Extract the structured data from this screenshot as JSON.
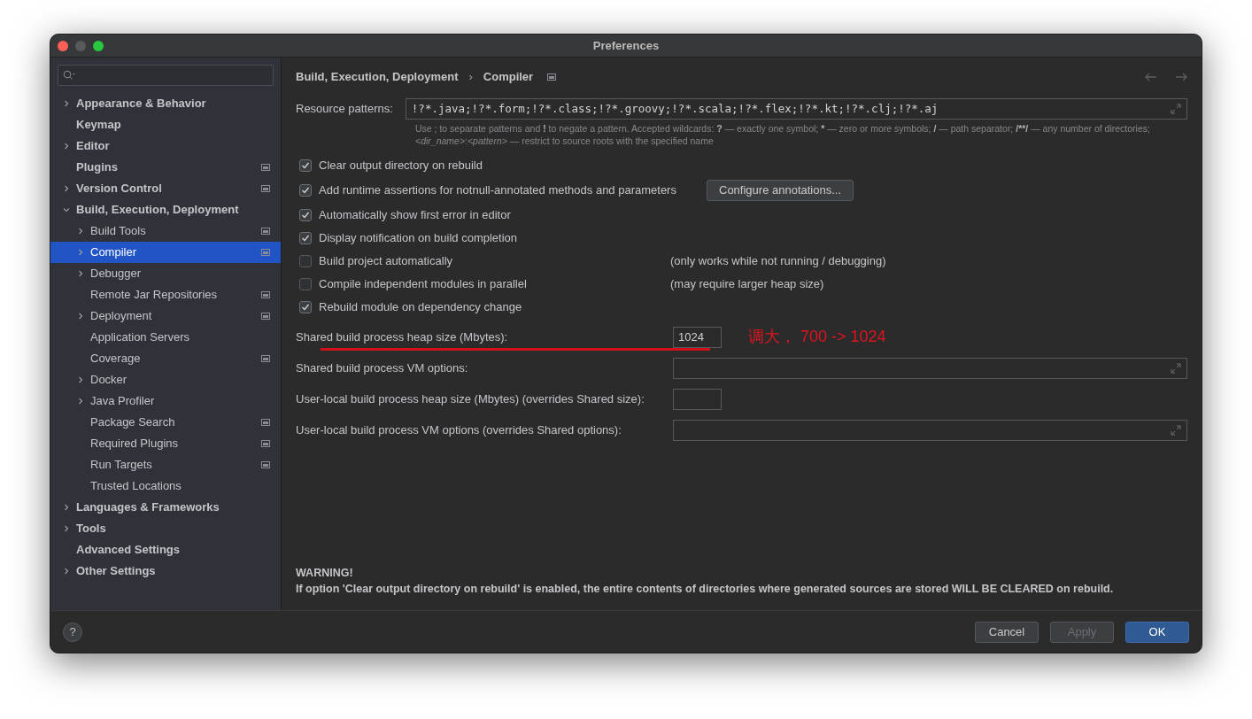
{
  "window": {
    "title": "Preferences"
  },
  "sidebar": {
    "items": [
      {
        "label": "Appearance & Behavior",
        "expandable": true,
        "expanded": false,
        "selected": false,
        "badge": false
      },
      {
        "label": "Keymap",
        "expandable": false,
        "selected": false,
        "badge": false
      },
      {
        "label": "Editor",
        "expandable": true,
        "expanded": false,
        "selected": false,
        "badge": false
      },
      {
        "label": "Plugins",
        "expandable": false,
        "selected": false,
        "badge": true
      },
      {
        "label": "Version Control",
        "expandable": true,
        "expanded": false,
        "selected": false,
        "badge": true
      },
      {
        "label": "Build, Execution, Deployment",
        "expandable": true,
        "expanded": true,
        "selected": false,
        "badge": false,
        "children": [
          {
            "label": "Build Tools",
            "expandable": true,
            "expanded": false,
            "selected": false,
            "badge": true
          },
          {
            "label": "Compiler",
            "expandable": true,
            "expanded": false,
            "selected": true,
            "badge": true
          },
          {
            "label": "Debugger",
            "expandable": true,
            "expanded": false,
            "selected": false,
            "badge": false
          },
          {
            "label": "Remote Jar Repositories",
            "expandable": false,
            "selected": false,
            "badge": true
          },
          {
            "label": "Deployment",
            "expandable": true,
            "expanded": false,
            "selected": false,
            "badge": true
          },
          {
            "label": "Application Servers",
            "expandable": false,
            "selected": false,
            "badge": false
          },
          {
            "label": "Coverage",
            "expandable": false,
            "selected": false,
            "badge": true
          },
          {
            "label": "Docker",
            "expandable": true,
            "expanded": false,
            "selected": false,
            "badge": false
          },
          {
            "label": "Java Profiler",
            "expandable": true,
            "expanded": false,
            "selected": false,
            "badge": false
          },
          {
            "label": "Package Search",
            "expandable": false,
            "selected": false,
            "badge": true
          },
          {
            "label": "Required Plugins",
            "expandable": false,
            "selected": false,
            "badge": true
          },
          {
            "label": "Run Targets",
            "expandable": false,
            "selected": false,
            "badge": true
          },
          {
            "label": "Trusted Locations",
            "expandable": false,
            "selected": false,
            "badge": false
          }
        ]
      },
      {
        "label": "Languages & Frameworks",
        "expandable": true,
        "expanded": false,
        "selected": false,
        "badge": false
      },
      {
        "label": "Tools",
        "expandable": true,
        "expanded": false,
        "selected": false,
        "badge": false
      },
      {
        "label": "Advanced Settings",
        "expandable": false,
        "selected": false,
        "badge": false
      },
      {
        "label": "Other Settings",
        "expandable": true,
        "expanded": false,
        "selected": false,
        "badge": false
      }
    ]
  },
  "breadcrumb": [
    "Build, Execution, Deployment",
    "Compiler"
  ],
  "breadcrumb_separator": "›",
  "help_button": "?",
  "resource_patterns": {
    "label": "Resource patterns:",
    "value": "!?*.java;!?*.form;!?*.class;!?*.groovy;!?*.scala;!?*.flex;!?*.kt;!?*.clj;!?*.aj",
    "hint": [
      {
        "text": "Use ; to separate patterns and "
      },
      {
        "text": "!",
        "bold": true
      },
      {
        "text": " to negate a pattern. Accepted wildcards: "
      },
      {
        "text": "?",
        "bold": true
      },
      {
        "text": " — exactly one symbol; "
      },
      {
        "text": "*",
        "bold": true
      },
      {
        "text": " — zero or more symbols; "
      },
      {
        "text": "/",
        "bold": true
      },
      {
        "text": " — path separator; "
      },
      {
        "text": "/**/",
        "bold": true
      },
      {
        "text": " — any number of directories; "
      },
      {
        "text": "<dir_name>",
        "italic": true
      },
      {
        "text": ":"
      },
      {
        "text": "<pattern>",
        "italic": true
      },
      {
        "text": " — restrict to source roots with the specified name"
      }
    ]
  },
  "options": [
    {
      "label": "Clear output directory on rebuild",
      "checked": true
    },
    {
      "label": "Add runtime assertions for notnull-annotated methods and parameters",
      "checked": true,
      "button": "Configure annotations..."
    },
    {
      "label": "Automatically show first error in editor",
      "checked": true
    },
    {
      "label": "Display notification on build completion",
      "checked": true
    },
    {
      "label": "Build project automatically",
      "checked": false,
      "note": "(only works while not running / debugging)"
    },
    {
      "label": "Compile independent modules in parallel",
      "checked": false,
      "note": "(may require larger heap size)"
    },
    {
      "label": "Rebuild module on dependency change",
      "checked": true
    }
  ],
  "fields": [
    {
      "label": "Shared build process heap size (Mbytes):",
      "kind": "short",
      "value": "1024",
      "annotation": "调大， 700 -> 1024"
    },
    {
      "label": "Shared build process VM options:",
      "kind": "wide"
    },
    {
      "label": "User-local build process heap size (Mbytes) (overrides Shared size):",
      "kind": "short"
    },
    {
      "label": "User-local build process VM options (overrides Shared options):",
      "kind": "wide"
    }
  ],
  "warning": {
    "title": "WARNING!",
    "text": "If option 'Clear output directory on rebuild' is enabled, the entire contents of directories where generated sources are stored WILL BE CLEARED on rebuild."
  },
  "buttons": [
    {
      "label": "Cancel",
      "kind": "normal",
      "disabled": false
    },
    {
      "label": "Apply",
      "kind": "normal",
      "disabled": true
    },
    {
      "label": "OK",
      "kind": "default",
      "disabled": false
    }
  ]
}
